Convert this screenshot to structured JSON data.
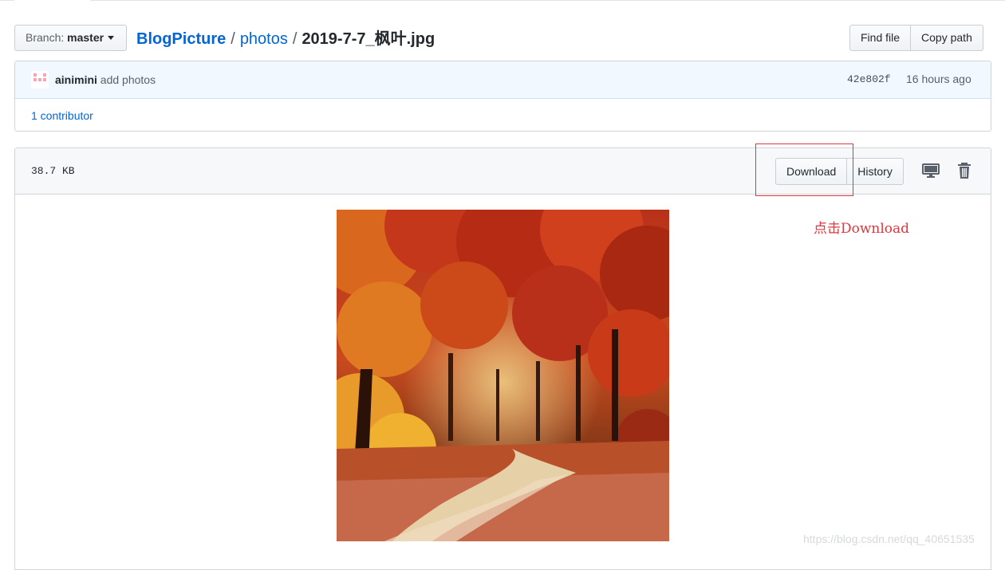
{
  "header": {
    "branch_label": "Branch:",
    "branch_value": "master",
    "breadcrumb": {
      "repo": "BlogPicture",
      "separator": "/",
      "dir": "photos",
      "file": "2019-7-7_枫叶.jpg"
    },
    "find_file": "Find file",
    "copy_path": "Copy path"
  },
  "commit": {
    "author": "ainimini",
    "message": "add photos",
    "sha": "42e802f",
    "time": "16 hours ago",
    "contributors": "1 contributor"
  },
  "file": {
    "size": "38.7 KB",
    "download": "Download",
    "history": "History",
    "desktop_icon": "desktop-icon",
    "trash_icon": "trash-icon"
  },
  "annotation": {
    "text": "点击Download",
    "color": "#e0353b"
  },
  "image": {
    "subject": "autumn forest path with red and orange maple trees"
  },
  "watermark": "https://blog.csdn.net/qq_40651535",
  "colors": {
    "link": "#0366d6",
    "commit_bg": "#f1f8ff",
    "header_bg": "#f6f8fa",
    "border": "#d1d5da"
  }
}
